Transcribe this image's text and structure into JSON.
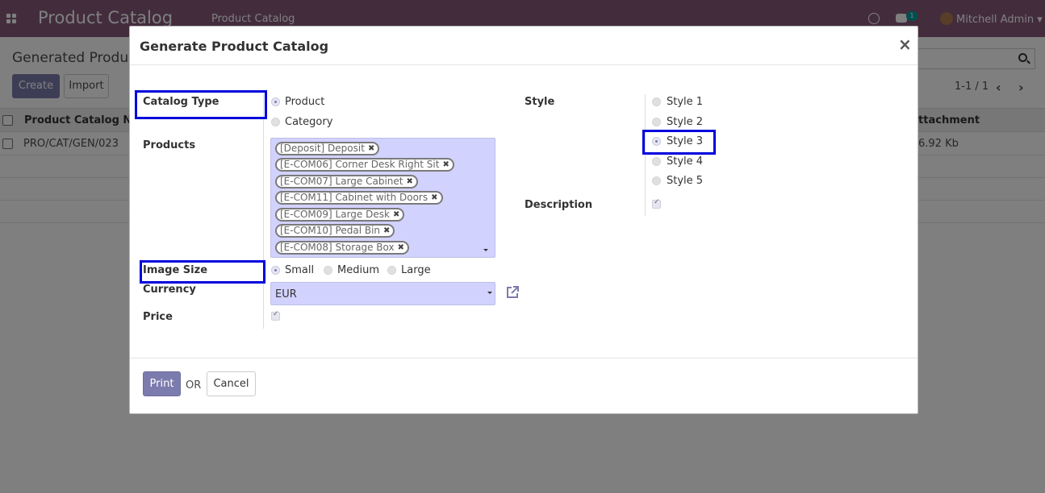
{
  "navbar": {
    "brand": "Product Catalog",
    "menu_item": "Product Catalog",
    "chat_badge": "1",
    "user_name": "Mitchell Admin"
  },
  "control_panel": {
    "breadcrumb_title": "Generated Produc",
    "create_label": "Create",
    "import_label": "Import",
    "pager": "1-1 / 1"
  },
  "list": {
    "columns": [
      "Product Catalog Num",
      "Attachment"
    ],
    "rows": [
      {
        "name": "PRO/CAT/GEN/023",
        "attachment": "6.92 Kb"
      }
    ]
  },
  "modal": {
    "title": "Generate Product Catalog",
    "close_symbol": "×",
    "catalog_type": {
      "label": "Catalog Type",
      "options": [
        "Product",
        "Category"
      ],
      "selected": "Product"
    },
    "products": {
      "label": "Products",
      "tags": [
        "[Deposit] Deposit",
        "[E-COM06] Corner Desk Right Sit",
        "[E-COM07] Large Cabinet",
        "[E-COM11] Cabinet with Doors",
        "[E-COM09] Large Desk",
        "[E-COM10] Pedal Bin",
        "[E-COM08] Storage Box"
      ]
    },
    "image_size": {
      "label": "Image Size",
      "options": [
        "Small",
        "Medium",
        "Large"
      ],
      "selected": "Small"
    },
    "currency": {
      "label": "Currency",
      "value": "EUR"
    },
    "price": {
      "label": "Price",
      "checked": true
    },
    "style": {
      "label": "Style",
      "options": [
        "Style 1",
        "Style 2",
        "Style 3",
        "Style 4",
        "Style 5"
      ],
      "selected": "Style 3"
    },
    "description": {
      "label": "Description",
      "checked": true
    },
    "footer": {
      "print_label": "Print",
      "or_text": "OR",
      "cancel_label": "Cancel"
    }
  },
  "colors": {
    "navbar": "#875a7b",
    "primary_button": "#7c7bad",
    "field_background": "#d2d2ff",
    "highlight_box": "#0000dd"
  }
}
